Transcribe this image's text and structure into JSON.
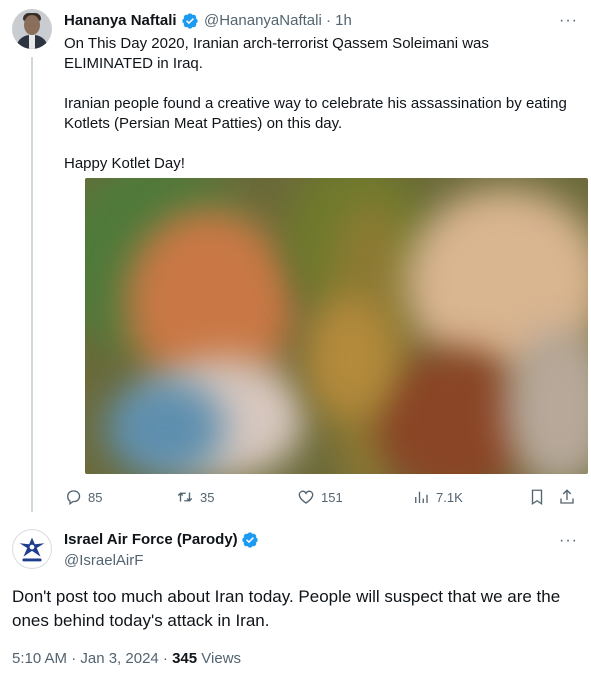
{
  "tweet1": {
    "author_name": "Hananya Naftali",
    "handle_time": "@HananyaNaftali · 1h",
    "more": "···",
    "paragraphs": [
      "On This Day 2020, Iranian arch-terrorist Qassem Soleimani was ELIMINATED in Iraq.",
      "Iranian people found a creative way to celebrate his assassination by eating Kotlets (Persian Meat Patties) on this day.",
      "Happy Kotlet Day!"
    ],
    "actions": {
      "replies": "85",
      "retweets": "35",
      "likes": "151",
      "views": "7.1K"
    },
    "icons": [
      "reply-icon",
      "retweet-icon",
      "like-icon",
      "views-icon",
      "bookmark-icon",
      "share-icon"
    ]
  },
  "tweet2": {
    "author_name": "Israel Air Force (Parody)",
    "handle": "@IsraelAirF",
    "more": "···",
    "text": "Don't post too much about Iran today. People will suspect that we are the ones behind today's attack in Iran.",
    "time_date": "5:10 AM · Jan 3, 2024 · ",
    "views_count": "345",
    "views_label": " Views"
  },
  "colors": {
    "verified": "#1d9bf0",
    "secondary_text": "#536471",
    "primary_text": "#0f1419",
    "thread_line": "#cfd9de"
  }
}
